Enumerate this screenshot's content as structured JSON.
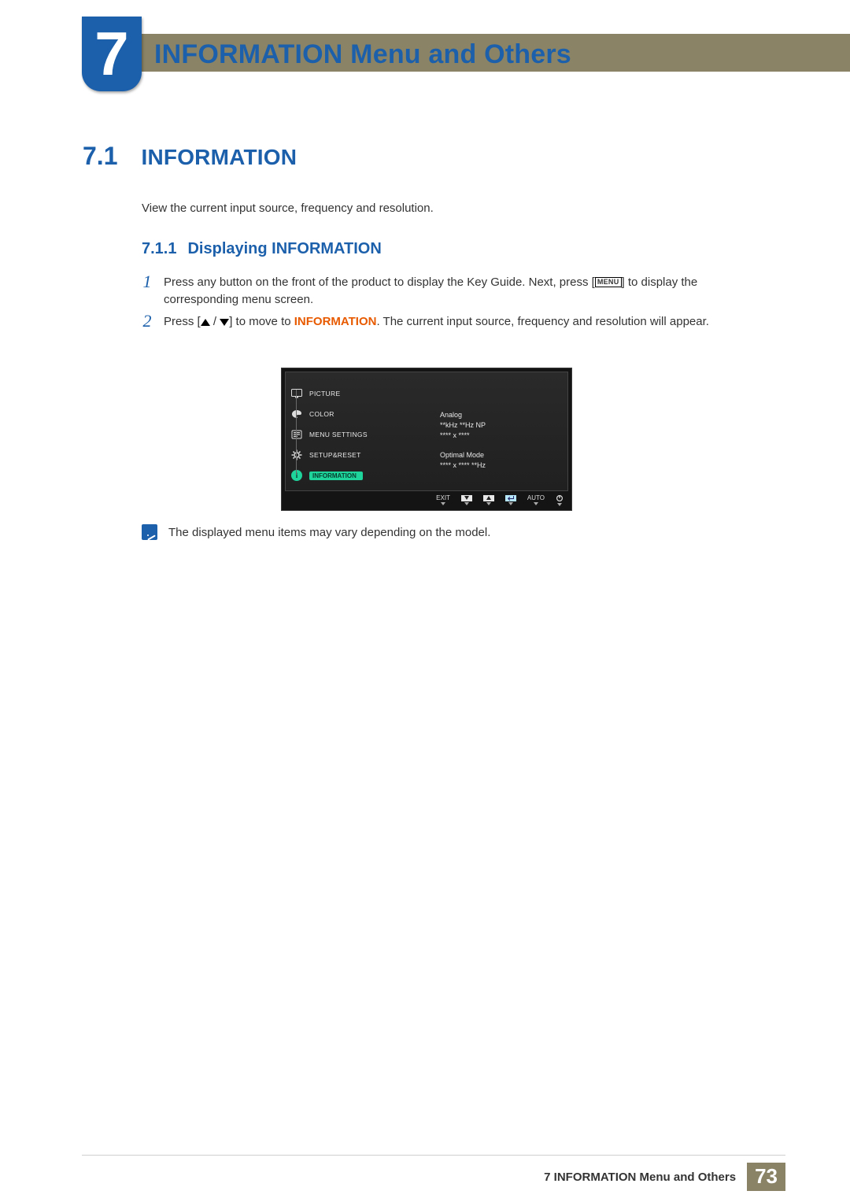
{
  "chapter": {
    "number": "7",
    "title": "INFORMATION Menu and Others"
  },
  "section": {
    "number": "7.1",
    "title": "INFORMATION"
  },
  "intro": "View the current input source, frequency and resolution.",
  "subsection": {
    "number": "7.1.1",
    "title": "Displaying INFORMATION"
  },
  "steps": {
    "s1": {
      "num": "1",
      "t1": "Press any button on the front of the product to display the Key Guide. Next, press [",
      "menu_label": "MENU",
      "t2": "] to display the corresponding menu screen."
    },
    "s2": {
      "num": "2",
      "t1": "Press [",
      "t2": "] to move to ",
      "hl": "INFORMATION",
      "t3": ". The current input source, frequency and resolution will appear."
    }
  },
  "osd": {
    "menu": {
      "picture": "PICTURE",
      "color": "COLOR",
      "menu_settings": "MENU SETTINGS",
      "setup_reset": "SETUP&RESET",
      "information": "INFORMATION"
    },
    "info": {
      "l1": "Analog",
      "l2": "**kHz **Hz NP",
      "l3": "**** x ****",
      "l4": "Optimal Mode",
      "l5": "**** x ****  **Hz"
    },
    "bottom": {
      "exit": "EXIT",
      "auto": "AUTO"
    }
  },
  "note": "The displayed menu items may vary depending on the model.",
  "footer": {
    "text": "7 INFORMATION Menu and Others",
    "page": "73"
  }
}
